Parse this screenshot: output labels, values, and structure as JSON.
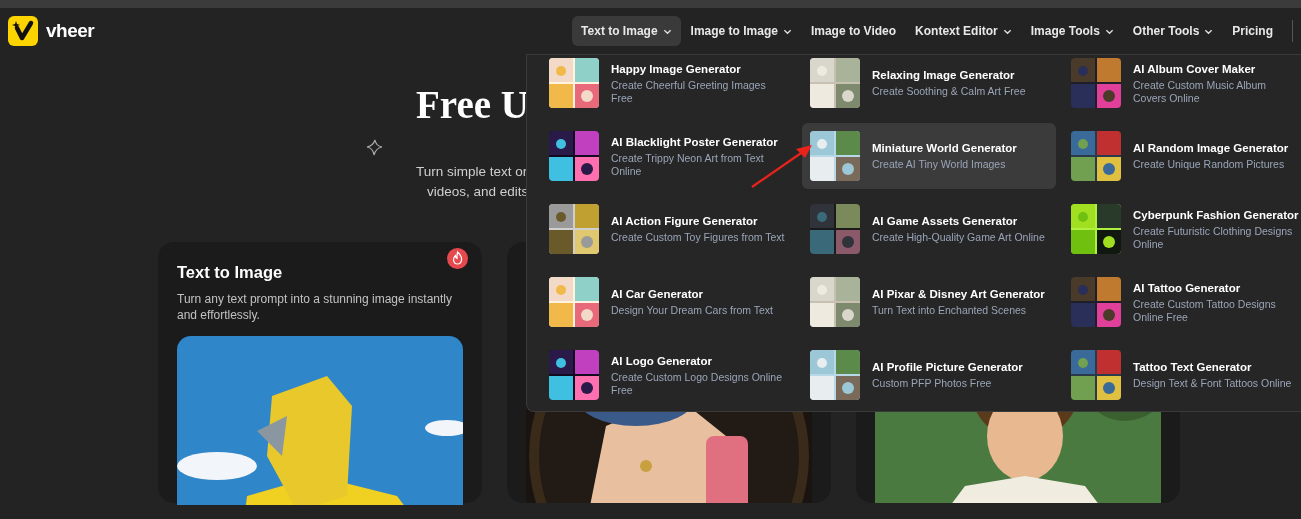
{
  "logo": {
    "text": "vheer"
  },
  "nav": [
    {
      "label": "Text to Image",
      "dropdown": true,
      "selected": true
    },
    {
      "label": "Image to Image",
      "dropdown": true,
      "selected": false
    },
    {
      "label": "Image to Video",
      "dropdown": false,
      "selected": false
    },
    {
      "label": "Kontext Editor",
      "dropdown": true,
      "selected": false
    },
    {
      "label": "Image Tools",
      "dropdown": true,
      "selected": false
    },
    {
      "label": "Other Tools",
      "dropdown": true,
      "selected": false
    },
    {
      "label": "Pricing",
      "dropdown": false,
      "selected": false
    }
  ],
  "hero": {
    "title": "Free U",
    "subtitle_lines": [
      "Turn simple text or",
      "videos, and edits"
    ]
  },
  "cards": [
    {
      "title": "Text to Image",
      "description": "Turn any text prompt into a stunning image instantly and effortlessly.",
      "hot": true,
      "image": {
        "kind": "picture"
      }
    },
    {
      "image": {
        "kind": "picture"
      }
    },
    {
      "image": {
        "kind": "picture"
      }
    }
  ],
  "menu": {
    "items": [
      {
        "title": "Happy Image Generator",
        "description": "Create Cheerful Greeting Images Free",
        "selected": false
      },
      {
        "title": "Relaxing Image Generator",
        "description": "Create Soothing & Calm Art Free",
        "selected": false
      },
      {
        "title": "AI Album Cover Maker",
        "description": "Create Custom Music Album Covers Online",
        "selected": false
      },
      {
        "title": "AI Blacklight Poster Generator",
        "description": "Create Trippy Neon Art from Text Online",
        "selected": false
      },
      {
        "title": "Miniature World Generator",
        "description": "Create AI Tiny World Images",
        "selected": true
      },
      {
        "title": "AI Random Image Generator",
        "description": "Create Unique Random Pictures",
        "selected": false
      },
      {
        "title": "AI Action Figure Generator",
        "description": "Create Custom Toy Figures from Text",
        "selected": false
      },
      {
        "title": "AI Game Assets Generator",
        "description": "Create High-Quality Game Art Online",
        "selected": false
      },
      {
        "title": "Cyberpunk Fashion Generator",
        "description": "Create Futuristic Clothing Designs Online",
        "selected": false
      },
      {
        "title": "AI Car Generator",
        "description": "Design Your Dream Cars from Text",
        "selected": false
      },
      {
        "title": "AI Pixar & Disney Art Generator",
        "description": "Turn Text into Enchanted Scenes",
        "selected": false
      },
      {
        "title": "AI Tattoo Generator",
        "description": "Create Custom Tattoo Designs Online Free",
        "selected": false
      },
      {
        "title": "AI Logo Generator",
        "description": "Create Custom Logo Designs Online Free",
        "selected": false
      },
      {
        "title": "AI Profile Picture Generator",
        "description": "Custom PFP Photos Free",
        "selected": false
      },
      {
        "title": "Tattoo Text Generator",
        "description": "Design Text & Font Tattoos Online",
        "selected": false
      }
    ]
  }
}
